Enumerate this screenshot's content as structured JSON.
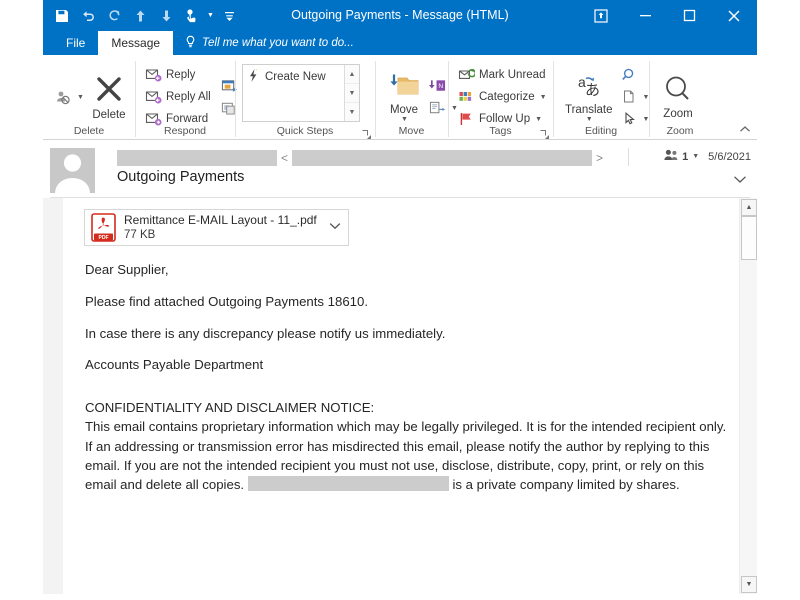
{
  "window": {
    "title": "Outgoing Payments - Message (HTML)",
    "quick_access": [
      {
        "name": "save-icon",
        "label": "Save"
      },
      {
        "name": "undo-icon",
        "label": "Undo"
      },
      {
        "name": "redo-icon",
        "label": "Redo"
      },
      {
        "name": "previous-item-icon",
        "label": "Previous Item"
      },
      {
        "name": "next-item-icon",
        "label": "Next Item"
      },
      {
        "name": "touch-mouse-mode-icon",
        "label": "Touch/Mouse Mode"
      },
      {
        "name": "customize-quick-access-toolbar-icon",
        "label": "Customize Quick Access Toolbar"
      }
    ],
    "controls": [
      {
        "name": "ribbon-display-options-button",
        "label": "Ribbon Display Options"
      },
      {
        "name": "minimize-button",
        "label": "Minimize"
      },
      {
        "name": "maximize-button",
        "label": "Maximize"
      },
      {
        "name": "close-button",
        "label": "Close"
      }
    ]
  },
  "tabs": {
    "file": "File",
    "message": "Message",
    "tellme": "Tell me what you want to do..."
  },
  "ribbon": {
    "groups": [
      {
        "label": "Delete",
        "ignore_label": "Ignore",
        "delete_label": "Delete"
      },
      {
        "label": "Respond",
        "reply": "Reply",
        "reply_all": "Reply All",
        "forward": "Forward",
        "meeting": "Meeting",
        "more": "More"
      },
      {
        "label": "Quick Steps",
        "create_new": "Create New"
      },
      {
        "label": "Move",
        "move": "Move",
        "onenote": "OneNote",
        "rules": "Rules"
      },
      {
        "label": "Tags",
        "mark_unread": "Mark Unread",
        "categorize": "Categorize",
        "follow_up": "Follow Up"
      },
      {
        "label": "Editing",
        "translate": "Translate",
        "find": "Find",
        "select": "Select",
        "pointer": "Pointer"
      },
      {
        "label": "Zoom",
        "zoom": "Zoom"
      }
    ],
    "collapse_label": "Collapse the Ribbon"
  },
  "message_header": {
    "sender_name_redacted": true,
    "sender_email_redacted": true,
    "angle_open": "<",
    "angle_close": ">",
    "recipient_count": "1",
    "date": "5/6/2021",
    "subject": "Outgoing Payments",
    "expand_label": "Expand header"
  },
  "attachment": {
    "name": "Remittance E-MAIL Layout - 11_.pdf",
    "size": "77 KB",
    "type": "pdf",
    "badge": "PDF"
  },
  "body": {
    "greeting": "Dear Supplier,",
    "line1": "Please find attached Outgoing Payments 18610.",
    "line2": "In case there is any discrepancy please notify us immediately.",
    "signature": "Accounts Payable Department",
    "disclaimer_heading": "CONFIDENTIALITY AND DISCLAIMER NOTICE:",
    "disclaimer_part1": "This email contains proprietary information which may be legally privileged. It is for the intended recipient only. If an addressing or transmission error has misdirected this email, please notify the author by replying to this email. If you are not the intended recipient you must not use, disclose, distribute, copy, print, or rely on this email and delete all copies.",
    "disclaimer_part2": "is a private company limited by shares."
  },
  "colors": {
    "titlebar": "#0072c6",
    "accent": "#0072c6",
    "pdf_red": "#d42b1f",
    "redaction": "#cccccc"
  }
}
